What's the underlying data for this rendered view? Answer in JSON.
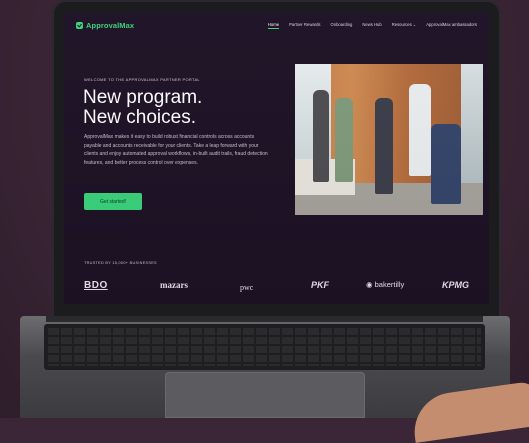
{
  "nav": {
    "logo": "ApprovalMax",
    "items": [
      {
        "label": "Home",
        "active": true
      },
      {
        "label": "Partner Rewards"
      },
      {
        "label": "Onboarding"
      },
      {
        "label": "News Hub"
      },
      {
        "label": "Resources",
        "dropdown": true
      },
      {
        "label": "ApprovalMax ambassadors"
      }
    ]
  },
  "hero": {
    "eyebrow": "WELCOME TO THE APPROVALMAX PARTNER PORTAL",
    "title_line1": "New program.",
    "title_line2": "New choices.",
    "lead": "ApprovalMax makes it easy to build robust financial controls across accounts payable and accounts receivable for your clients. Take a leap forward with your clients and enjoy automated approval workflows, in-built audit trails, fraud detection features, and better process control over expenses.",
    "cta": "Get started!"
  },
  "trusted": {
    "label": "TRUSTED BY 15,000+ BUSINESSES",
    "logos": [
      "BDO",
      "mazars",
      "pwc",
      "PKF",
      "bakertilly",
      "KPMG"
    ]
  },
  "colors": {
    "accent": "#3ad37b",
    "background": "#1d1225"
  }
}
